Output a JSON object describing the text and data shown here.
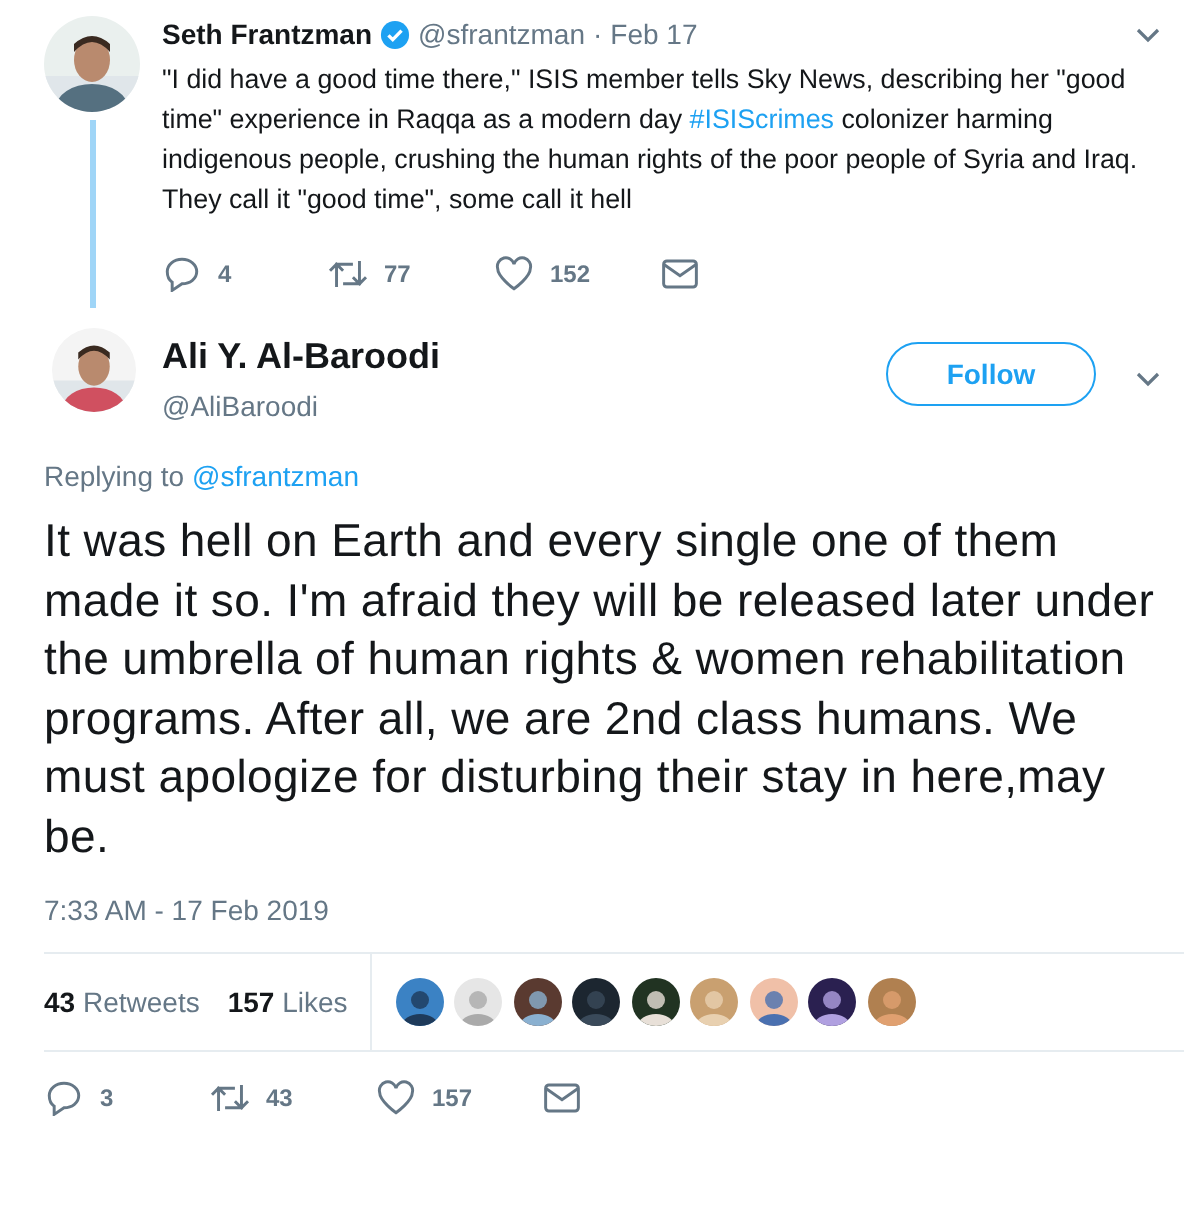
{
  "parent_tweet": {
    "name": "Seth Frantzman",
    "verified": true,
    "handle": "@sfrantzman",
    "dot": "·",
    "date": "Feb 17",
    "text": "\"I did have a good time there,\" ISIS member tells Sky News, describing her \"good time\" experience in Raqqa as a modern day ",
    "hashtag": "#ISIScrimes",
    "text_after": " colonizer harming indigenous people, crushing the human rights of the poor people of Syria and Iraq. They call it \"good time\", some call it hell",
    "actions": [
      {
        "kind": "reply",
        "count": "4"
      },
      {
        "kind": "retweet",
        "count": "77"
      },
      {
        "kind": "like",
        "count": "152"
      },
      {
        "kind": "message"
      }
    ]
  },
  "tweet": {
    "name": "Ali Y. Al-Baroodi",
    "handle": "@AliBaroodi",
    "follow_button": "Follow",
    "replying_label": "Replying to",
    "replying_handle": "@sfrantzman",
    "text": "It was hell on Earth and every single one of them made it so. I'm afraid they will be released later under the umbrella of human rights & women rehabilitation programs. After all, we are 2nd class humans. We must apologize for disturbing their stay in here,may be.",
    "timestamp": "7:33 AM - 17 Feb 2019",
    "stats": [
      {
        "count": "43",
        "label": "Retweets"
      },
      {
        "count": "157",
        "label": "Likes"
      }
    ],
    "actions": [
      {
        "kind": "reply",
        "count": "3"
      },
      {
        "kind": "retweet",
        "count": "43"
      },
      {
        "kind": "like",
        "count": "157"
      },
      {
        "kind": "message"
      }
    ]
  }
}
